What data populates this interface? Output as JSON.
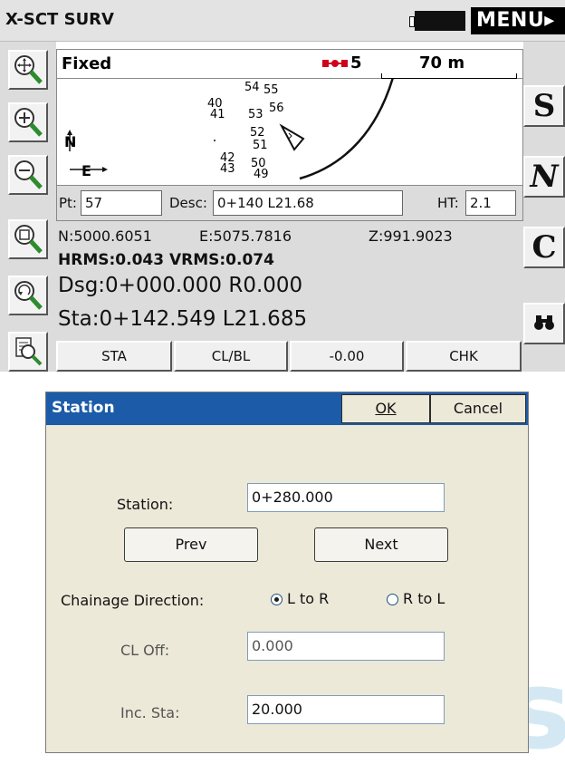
{
  "app": {
    "title": "X-SCT SURV",
    "menu_label": "MENU",
    "menu_arrow": "▸"
  },
  "toolbar_left": [
    {
      "icon": "zoom-extents-icon"
    },
    {
      "icon": "zoom-in-icon"
    },
    {
      "icon": "zoom-out-icon"
    },
    {
      "icon": "zoom-window-icon"
    },
    {
      "icon": "zoom-previous-icon"
    },
    {
      "icon": "zoom-list-icon"
    }
  ],
  "toolbar_right": [
    {
      "label": "S"
    },
    {
      "label": "N"
    },
    {
      "label": "C"
    },
    {
      "label": "🔭",
      "icon": "binoculars-icon"
    }
  ],
  "status": {
    "fix": "Fixed",
    "satellites": "5",
    "scale": "70 m"
  },
  "map": {
    "north_label": "N",
    "east_label": "E",
    "points": [
      "54",
      "55",
      "40",
      "41",
      "53",
      "56",
      "52",
      "51",
      "42",
      "43",
      "50",
      "49"
    ]
  },
  "inputs": {
    "pt_label": "Pt:",
    "pt_value": "57",
    "desc_label": "Desc:",
    "desc_value": "0+140 L21.68",
    "ht_label": "HT:",
    "ht_value": "2.1"
  },
  "coords": {
    "n": "N:5000.6051",
    "e": "E:5075.7816",
    "z": "Z:991.9023",
    "hrms": "HRMS:0.043 VRMS:0.074",
    "dsg": "Dsg:0+000.000 R0.000",
    "sta": "Sta:0+142.549 L21.685"
  },
  "bottom_buttons": [
    "STA",
    "CL/BL",
    "-0.00",
    "CHK"
  ],
  "dialog": {
    "title": "Station",
    "ok": "OK",
    "cancel": "Cancel",
    "station_label": "Station:",
    "station_value": "0+280.000",
    "prev": "Prev",
    "next": "Next",
    "chainage_label": "Chainage Direction:",
    "option_l_to_r": "L to R",
    "option_r_to_l": "R to L",
    "selected": "L to R",
    "cl_off_label": "CL Off:",
    "cl_off_value": "0.000",
    "inc_sta_label": "Inc. Sta:",
    "inc_sta_value": "20.000"
  },
  "watermark": "Geodesic",
  "colors": {
    "dialog_title_bg": "#1b5ba8",
    "sat_icon": "#d0021b"
  }
}
